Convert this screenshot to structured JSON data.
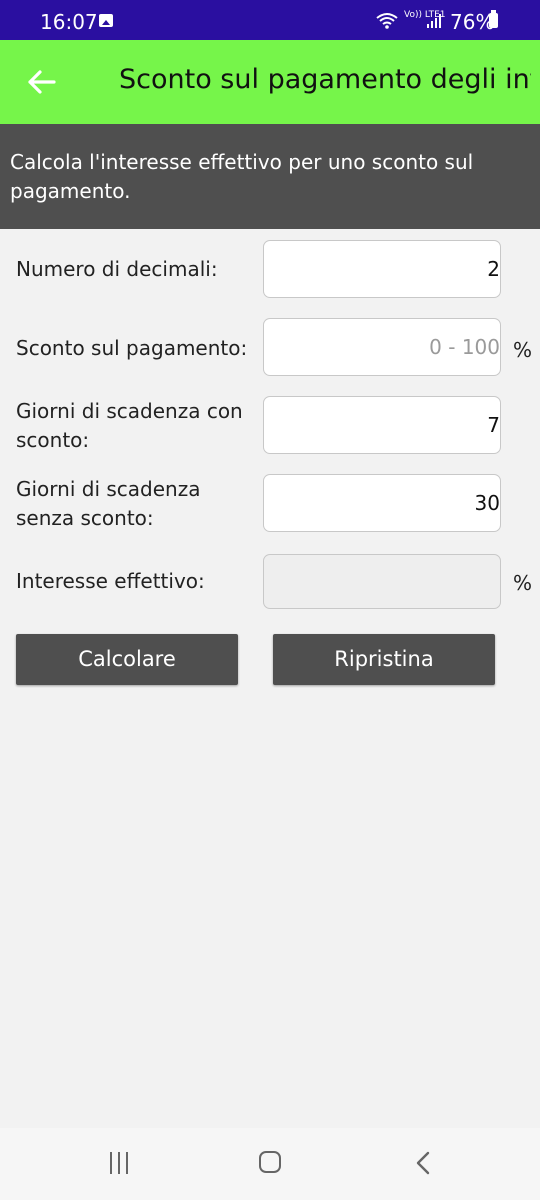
{
  "status_bar": {
    "time": "16:07",
    "network_label": "Vo)) LTE1",
    "battery": "76%"
  },
  "toolbar": {
    "title": "Sconto sul pagamento degli int..."
  },
  "banner": {
    "text": "Calcola l'interesse effettivo per uno sconto sul pagamento."
  },
  "form": {
    "decimals": {
      "label": "Numero di decimali:",
      "value": "2"
    },
    "discount": {
      "label": "Sconto sul pagamento:",
      "placeholder": "0 - 100",
      "unit": "%"
    },
    "days_with_discount": {
      "label": "Giorni di scadenza con sconto:",
      "value": "7"
    },
    "days_without_discount": {
      "label": "Giorni di scadenza senza sconto:",
      "value": "30"
    },
    "effective_interest": {
      "label": "Interesse effettivo:",
      "value": "",
      "unit": "%"
    }
  },
  "buttons": {
    "calculate": "Calcolare",
    "reset": "Ripristina"
  },
  "colors": {
    "status_bar": "#2a0fa0",
    "toolbar": "#76f54a",
    "banner": "#4f4f4f",
    "button": "#4f4f4f",
    "background": "#f2f2f2"
  },
  "icons": [
    "image-icon",
    "wifi-icon",
    "signal-icon",
    "battery-icon",
    "back-arrow-icon",
    "recents-icon",
    "home-icon",
    "back-nav-icon"
  ]
}
